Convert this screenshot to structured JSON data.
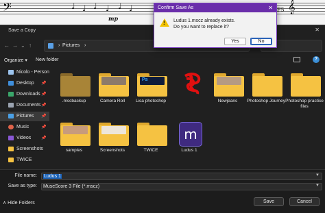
{
  "background_score": {
    "dynamic": "mp",
    "clef_right": "F5"
  },
  "dialog": {
    "title": "Save a Copy",
    "close_glyph": "✕",
    "nav": {
      "back": "←",
      "forward": "→",
      "down": "⌄",
      "up": "↑",
      "refresh": "⟳"
    },
    "path": [
      "Pictures",
      "›"
    ],
    "organize": "Organize ▾",
    "new_folder": "New folder",
    "help": "?"
  },
  "sidebar": {
    "items": [
      {
        "label": "Nicolo - Person",
        "icon": "cloud-icon",
        "pinned": false,
        "selected": false
      },
      {
        "label": "Desktop",
        "icon": "desktop-icon",
        "pinned": true,
        "selected": false
      },
      {
        "label": "Downloads",
        "icon": "download-icon",
        "pinned": true,
        "selected": false
      },
      {
        "label": "Documents",
        "icon": "documents-icon",
        "pinned": true,
        "selected": false
      },
      {
        "label": "Pictures",
        "icon": "pictures-icon",
        "pinned": true,
        "selected": true
      },
      {
        "label": "Music",
        "icon": "music-icon",
        "pinned": true,
        "selected": false
      },
      {
        "label": "Videos",
        "icon": "videos-icon",
        "pinned": true,
        "selected": false
      },
      {
        "label": "Screenshots",
        "icon": "folder-icon",
        "pinned": false,
        "selected": false
      },
      {
        "label": "TWICE",
        "icon": "folder-icon",
        "pinned": false,
        "selected": false
      }
    ],
    "pin_glyph": "📌"
  },
  "files": [
    {
      "name": ".mscbackup",
      "type": "folder"
    },
    {
      "name": "Camera Roll",
      "type": "folder"
    },
    {
      "name": "Lisa photoshop",
      "type": "folder"
    },
    {
      "name": "",
      "type": "scribble"
    },
    {
      "name": "Newjeans",
      "type": "folder"
    },
    {
      "name": "Photoshop Journey",
      "type": "folder"
    },
    {
      "name": "Photoshop practice files",
      "type": "folder"
    },
    {
      "name": "samples",
      "type": "folder"
    },
    {
      "name": "Screenshots",
      "type": "folder"
    },
    {
      "name": "TWICE",
      "type": "folder"
    },
    {
      "name": "Ludus 1",
      "type": "musescore"
    }
  ],
  "form": {
    "file_name_label": "File name:",
    "file_name_value": "Ludus 1",
    "save_as_type_label": "Save as type:",
    "save_as_type_value": "MuseScore 3 File (*.mscz)",
    "hide_folders": "∧  Hide Folders",
    "save": "Save",
    "cancel": "Cancel"
  },
  "confirm": {
    "title": "Confirm Save As",
    "close_glyph": "✕",
    "line1": "Ludus 1.mscz already exists.",
    "line2": "Do you want to replace it?",
    "yes": "Yes",
    "no": "No",
    "warning_mark": "!"
  },
  "colors": {
    "folder": "#f5c242",
    "accent_purple": "#6a2eaa",
    "selection_blue": "#1a62b8",
    "musescore_tile": "#3f2a80"
  }
}
